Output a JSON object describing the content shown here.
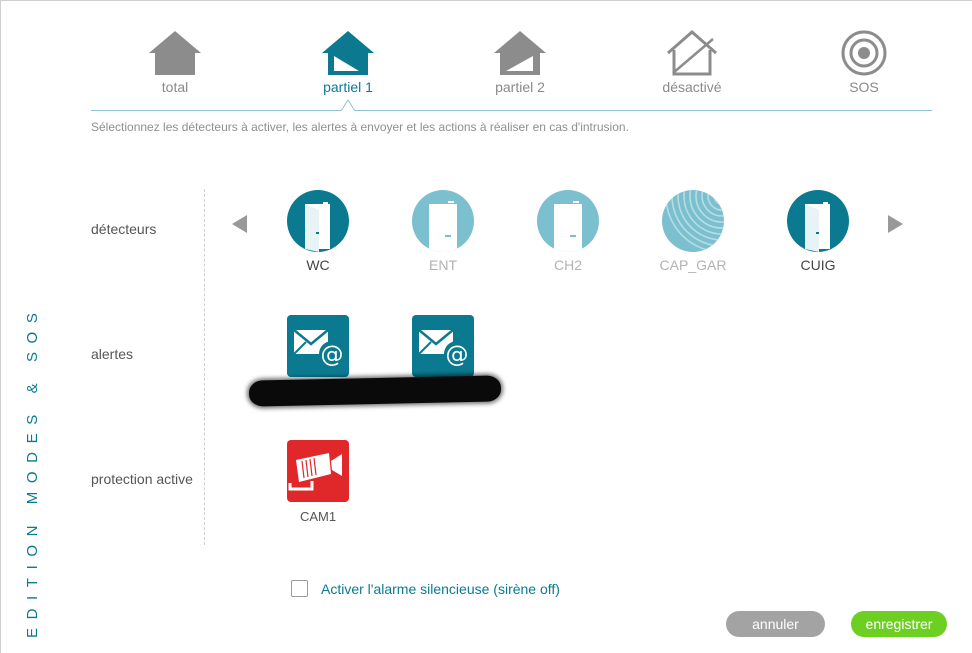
{
  "sidebar": {
    "title": "EDITION MODES & SOS"
  },
  "tabs": [
    {
      "label": "total",
      "icon": "house-filled-icon",
      "active": false
    },
    {
      "label": "partiel 1",
      "icon": "house-partial-icon",
      "active": true
    },
    {
      "label": "partiel 2",
      "icon": "house-partial-icon",
      "active": false
    },
    {
      "label": "désactivé",
      "icon": "house-outline-crossed-icon",
      "active": false
    },
    {
      "label": "SOS",
      "icon": "target-icon",
      "active": false
    }
  ],
  "instructions": "Sélectionnez les détecteurs à activer, les alertes à envoyer et les actions à réaliser en cas d'intrusion.",
  "sections": {
    "detectors_label": "détecteurs",
    "alerts_label": "alertes",
    "protection_label": "protection active"
  },
  "detectors": [
    {
      "label": "WC",
      "icon": "door-icon",
      "enabled": true
    },
    {
      "label": "ENT",
      "icon": "door-icon",
      "enabled": false
    },
    {
      "label": "CH2",
      "icon": "door-icon",
      "enabled": false
    },
    {
      "label": "CAP_GAR",
      "icon": "motion-sensor-icon",
      "enabled": false
    },
    {
      "label": "CUIG",
      "icon": "door-icon",
      "enabled": true
    }
  ],
  "alerts": [
    {
      "icon": "email-alert-icon"
    },
    {
      "icon": "email-alert-icon"
    }
  ],
  "protection": [
    {
      "label": "CAM1",
      "icon": "camera-icon"
    }
  ],
  "silent_alarm": {
    "label": "Activer l'alarme silencieuse (sirène off)",
    "checked": false
  },
  "buttons": {
    "cancel": "annuler",
    "save": "enregistrer"
  },
  "colors": {
    "accent": "#0b7a90",
    "inactive": "#7cc0cf",
    "camera": "#e0282b",
    "save": "#6dcf22",
    "cancel": "#a3a3a3"
  }
}
